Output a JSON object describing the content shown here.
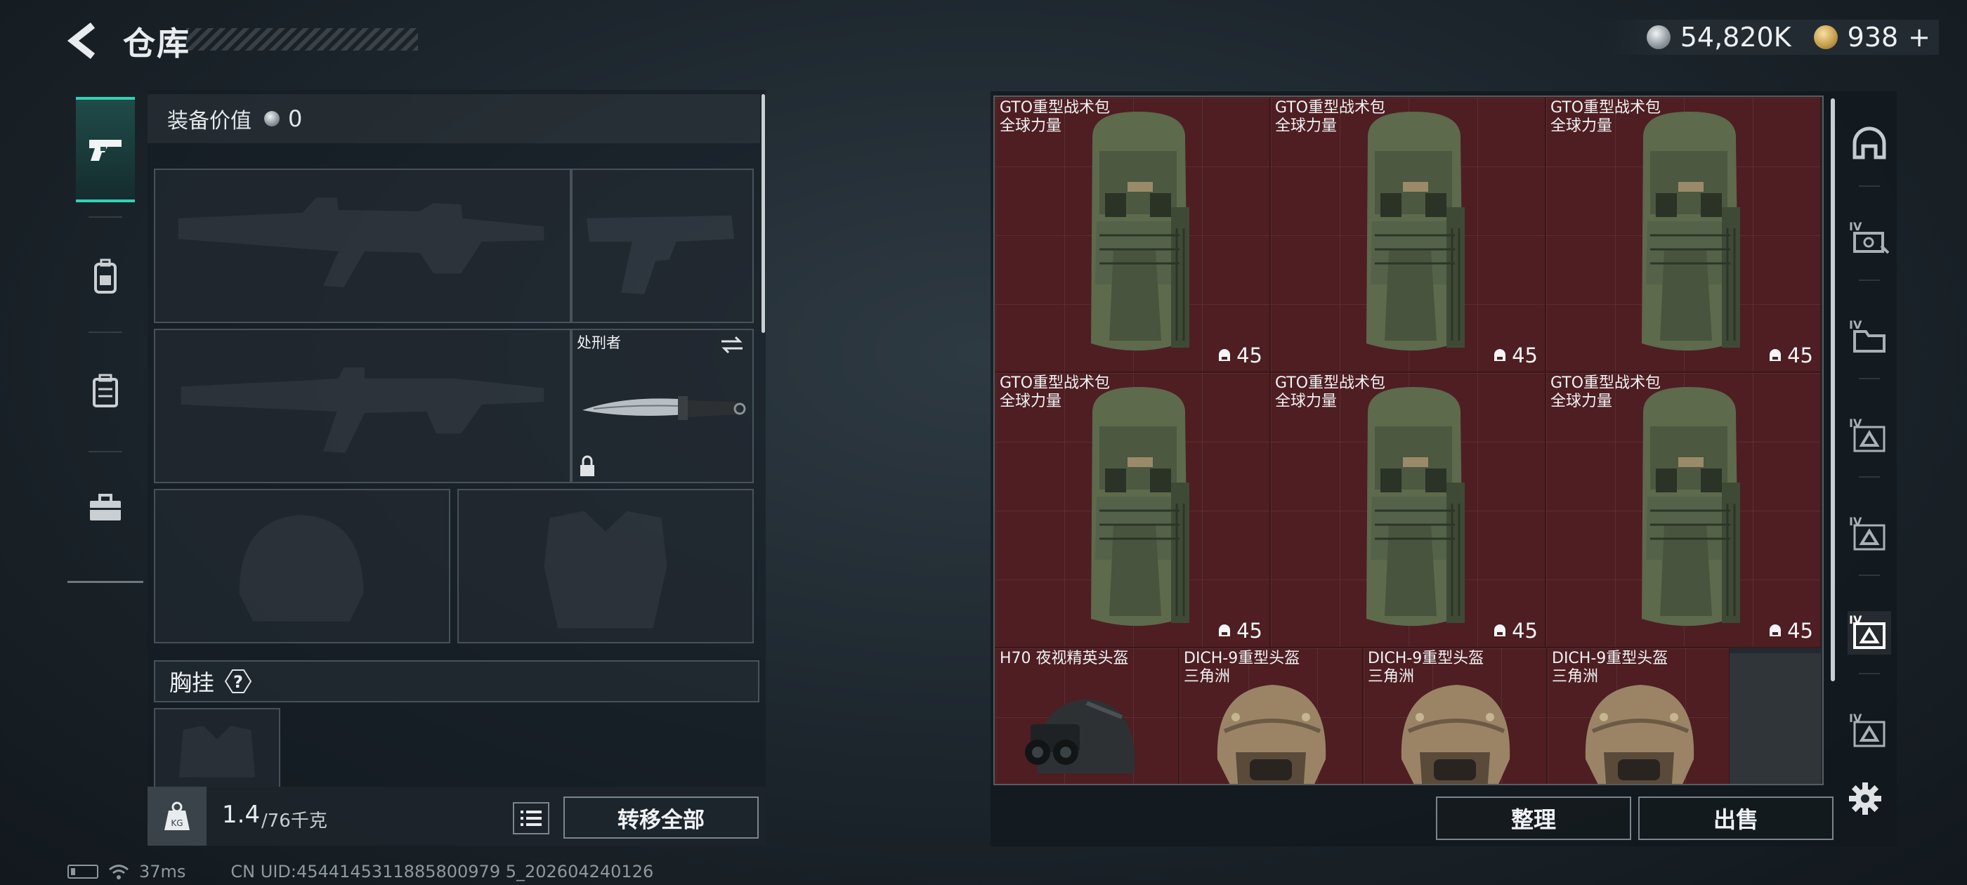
{
  "header": {
    "title": "仓库"
  },
  "currency": {
    "silver": "54,820K",
    "gold": "938",
    "add_symbol": "+"
  },
  "equipment": {
    "value_label": "装备价值",
    "value": "0",
    "knife_name": "处刑者",
    "chest_label": "胸挂",
    "chest_help": "?"
  },
  "weight": {
    "current": "1.4",
    "max": "/76千克"
  },
  "buttons": {
    "transfer_all": "转移全部",
    "sort": "整理",
    "sell": "出售"
  },
  "status": {
    "ping": "37ms",
    "uid": "CN UID:4544145311885800979 5_202604240126"
  },
  "stash": {
    "items": [
      {
        "name": "GTO重型战术包",
        "brand": "全球力量",
        "count": "45"
      },
      {
        "name": "GTO重型战术包",
        "brand": "全球力量",
        "count": "45"
      },
      {
        "name": "GTO重型战术包",
        "brand": "全球力量",
        "count": "45"
      },
      {
        "name": "GTO重型战术包",
        "brand": "全球力量",
        "count": "45"
      },
      {
        "name": "GTO重型战术包",
        "brand": "全球力量",
        "count": "45"
      },
      {
        "name": "GTO重型战术包",
        "brand": "全球力量",
        "count": "45"
      },
      {
        "name": "H70 夜视精英头盔",
        "brand": ""
      },
      {
        "name": "DICH-9重型头盔",
        "brand": "三角洲"
      },
      {
        "name": "DICH-9重型头盔",
        "brand": "三角洲"
      },
      {
        "name": "DICH-9重型头盔",
        "brand": "三角洲"
      }
    ]
  },
  "icons": {
    "back": "back-arrow-icon",
    "nav": [
      "pistol-icon",
      "backpack-icon",
      "rig-icon",
      "toolbox-icon"
    ],
    "categories": [
      "helmet-category-icon",
      "gear-iv-icon",
      "folder-iv-icon",
      "triangle-iv-icon",
      "triangle-iv-icon-2",
      "triangle-iv-icon-selected",
      "triangle-iv-icon-3"
    ],
    "settings": "gear-icon"
  },
  "colors": {
    "accent": "#2fd3b6",
    "item_bg": "#4e1e22"
  }
}
